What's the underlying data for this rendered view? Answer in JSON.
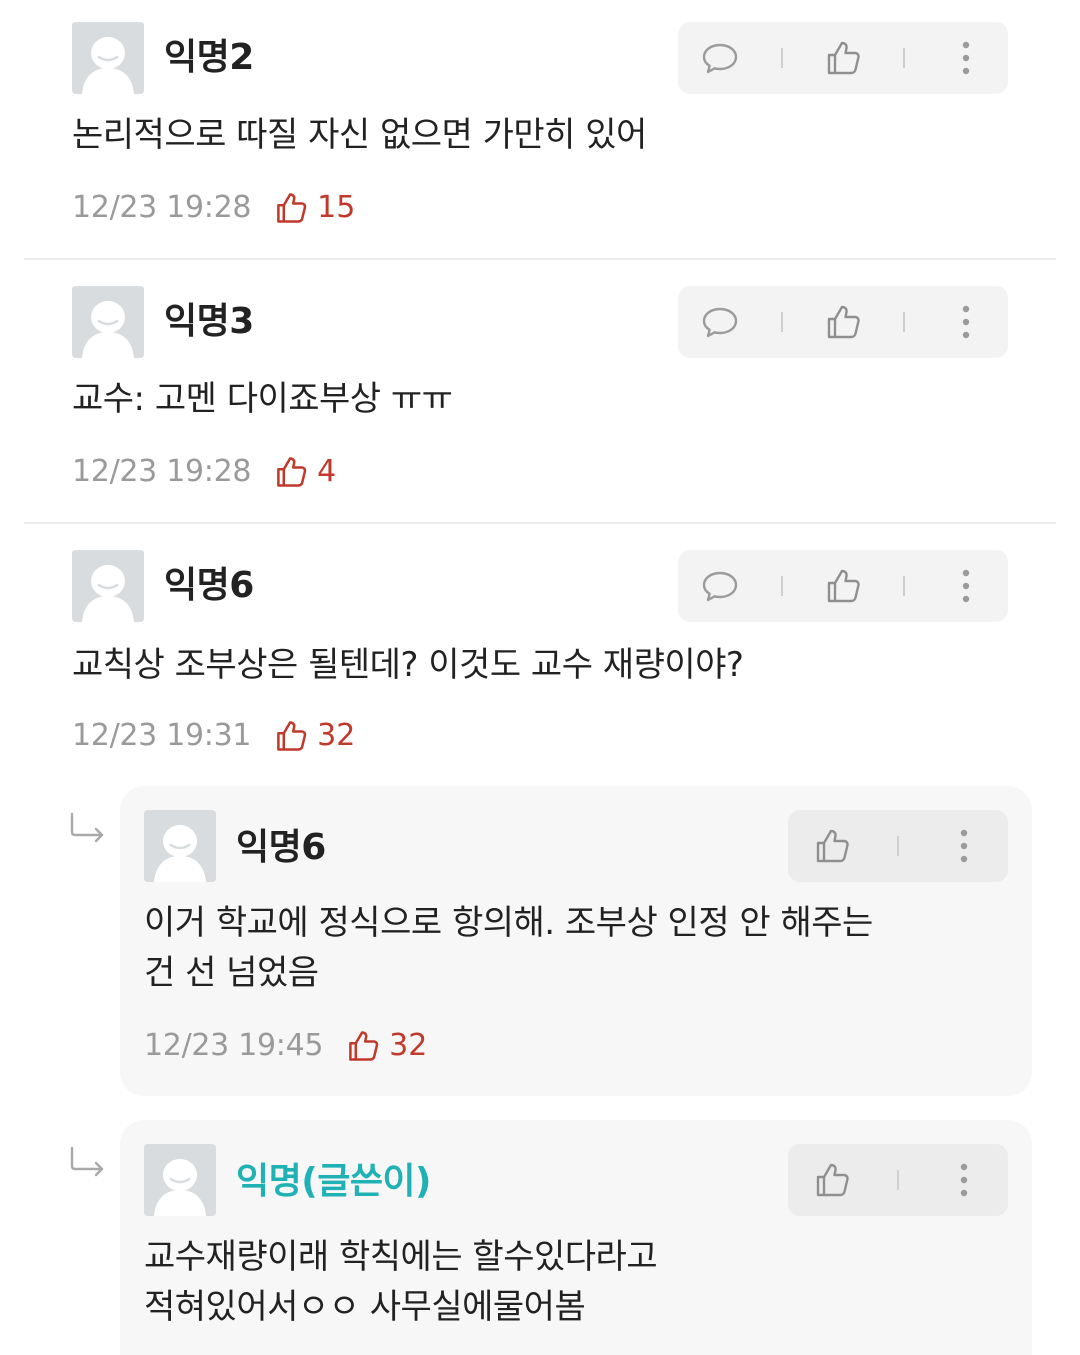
{
  "comments": [
    {
      "author": "익명2",
      "text": "논리적으로 따질 자신 없으면 가만히 있어",
      "time": "12/23 19:28",
      "likes": "15"
    },
    {
      "author": "익명3",
      "text": "교수: 고멘 다이죠부상 ㅠㅠ",
      "time": "12/23 19:28",
      "likes": "4"
    },
    {
      "author": "익명6",
      "text": "교칙상 조부상은 될텐데? 이것도 교수 재량이야?",
      "time": "12/23 19:31",
      "likes": "32"
    }
  ],
  "replies": [
    {
      "author": "익명6",
      "text_line1": "이거 학교에 정식으로 항의해. 조부상 인정 안 해주는",
      "text_line2": "건 선 넘었음",
      "time": "12/23 19:45",
      "likes": "32"
    },
    {
      "author": "익명(글쓴이)",
      "text_line1": "교수재량이래 학칙에는 할수있다라고",
      "text_line2": "적혀있어서ㅇㅇ 사무실에물어봄"
    }
  ],
  "icons": {
    "reply": "speech-bubble-icon",
    "like": "thumbs-up-icon",
    "more": "vertical-dots-icon",
    "reply_indicator": "reply-arrow-icon"
  },
  "colors": {
    "op_author": "#1fb1b4",
    "likes": "#c0392b",
    "time": "#9a9a9a"
  }
}
